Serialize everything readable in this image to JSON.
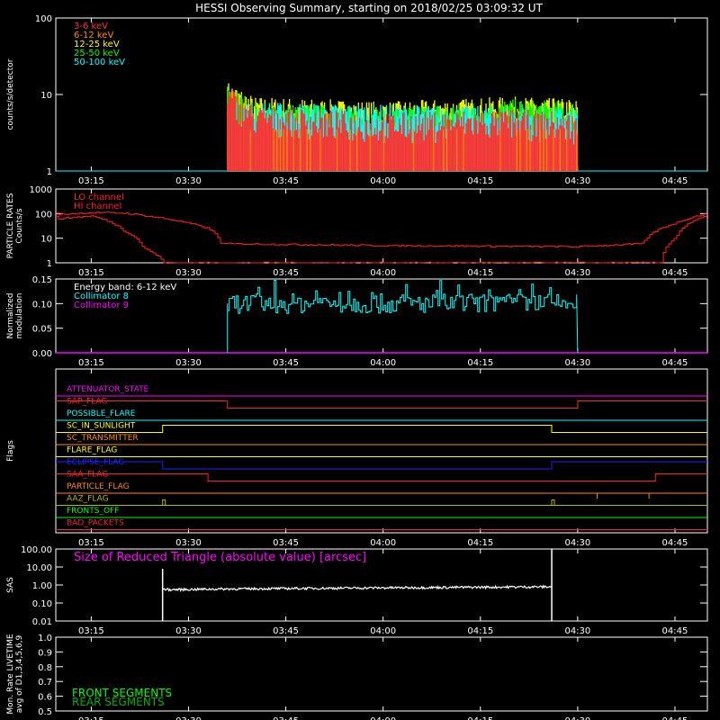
{
  "title": "HESSI Observing Summary, starting on 2018/02/25 03:09:32 UT",
  "time_ticks": [
    "03:15",
    "03:30",
    "03:45",
    "04:00",
    "04:15",
    "04:30",
    "04:45"
  ],
  "chart_data": [
    {
      "type": "line",
      "panel": "count-rates",
      "ylabel": "counts/s/detector",
      "yscale": "log",
      "ylim": [
        1,
        100
      ],
      "yticks": [
        "1",
        "10",
        "100"
      ],
      "xlim": [
        "03:09:32",
        "04:50"
      ],
      "legend": [
        {
          "name": "3-6 keV",
          "color": "#ff3030"
        },
        {
          "name": "6-12 keV",
          "color": "#ff8c00"
        },
        {
          "name": "12-25 keV",
          "color": "#ffff00"
        },
        {
          "name": "25-50 keV",
          "color": "#00ff00"
        },
        {
          "name": "50-100 keV",
          "color": "#00ffff"
        }
      ],
      "series": [
        {
          "name": "6-12 keV",
          "x": [
            "03:09:32",
            "03:36",
            "03:36",
            "04:30",
            "04:30",
            "04:50"
          ],
          "y": [
            1,
            1,
            3.5,
            3.5,
            1,
            1
          ],
          "color": "#ff8c00"
        },
        {
          "name": "3-6 keV",
          "x": [
            "03:36",
            "03:40",
            "04:00",
            "04:20",
            "04:30"
          ],
          "y": [
            9,
            5,
            4,
            4.5,
            4
          ],
          "color": "#ff3030"
        },
        {
          "name": "12-25 keV",
          "x": [
            "03:36",
            "03:40",
            "04:00",
            "04:20",
            "04:30"
          ],
          "y": [
            11,
            7,
            6,
            7,
            6.5
          ],
          "color": "#ffff00"
        },
        {
          "name": "25-50 keV",
          "x": [
            "03:36",
            "03:40",
            "04:00",
            "04:20",
            "04:30"
          ],
          "y": [
            10,
            6,
            5,
            6.5,
            6
          ],
          "color": "#00ff00"
        },
        {
          "name": "50-100 keV",
          "x": [
            "03:09:32",
            "03:36",
            "03:36",
            "04:30",
            "04:30",
            "04:50"
          ],
          "y": [
            1,
            1,
            6,
            5,
            1,
            1
          ],
          "color": "#00ffff"
        }
      ]
    },
    {
      "type": "line",
      "panel": "particle-rates",
      "ylabel": "PARTICLE RATES Counts/s",
      "yscale": "log",
      "ylim": [
        1,
        1000
      ],
      "yticks": [
        "1",
        "10",
        "100",
        "1000"
      ],
      "legend": [
        {
          "name": "LO channel",
          "color": "#ff2020"
        },
        {
          "name": "HI channel",
          "color": "#ff2020"
        }
      ],
      "series": [
        {
          "name": "LO channel",
          "x": [
            "03:09:32",
            "03:15",
            "03:20",
            "03:25",
            "03:31",
            "03:33",
            "03:35",
            "04:00",
            "04:30",
            "04:40",
            "04:45",
            "04:50"
          ],
          "y": [
            90,
            110,
            105,
            70,
            35,
            25,
            6,
            5,
            4.5,
            6,
            40,
            100
          ],
          "color": "#ff2020"
        },
        {
          "name": "HI channel",
          "x": [
            "03:09:32",
            "03:15",
            "03:20",
            "03:23",
            "03:25",
            "03:26",
            "03:26",
            "04:43",
            "04:43",
            "04:45",
            "04:50"
          ],
          "y": [
            60,
            80,
            20,
            4,
            2,
            1.3,
            1,
            1,
            2,
            10,
            80
          ],
          "color": "#ff2020"
        }
      ]
    },
    {
      "type": "line",
      "panel": "modulation",
      "ylabel": "Normalized modulation",
      "ylim": [
        0,
        0.15
      ],
      "yticks": [
        "0.00",
        "0.05",
        "0.10",
        "0.15"
      ],
      "legend": [
        {
          "name": "Energy band: 6-12 keV",
          "color": "#ffffff"
        },
        {
          "name": "Collimator 8",
          "color": "#00ffff"
        },
        {
          "name": "Collimator 9",
          "color": "#ff00ff"
        }
      ],
      "series": [
        {
          "name": "Collimator 8",
          "x": [
            "03:36",
            "04:30"
          ],
          "y": [
            0.1,
            0.1
          ],
          "color": "#00ffff"
        },
        {
          "name": "Collimator 9",
          "x": [
            "03:09:32",
            "04:50"
          ],
          "y": [
            0,
            0
          ],
          "color": "#ff00ff"
        }
      ]
    },
    {
      "type": "line",
      "panel": "flags",
      "ylabel": "Flags",
      "flags": [
        {
          "name": "ATTENUATOR_STATE",
          "color": "#ff00ff",
          "segments": [
            [
              "03:09:32",
              "04:50",
              0
            ]
          ]
        },
        {
          "name": "SAP_FLAG",
          "color": "#ff2020",
          "segments": [
            [
              "03:09:32",
              "03:36",
              1
            ],
            [
              "03:36",
              "04:30",
              0
            ],
            [
              "04:30",
              "04:50",
              1
            ]
          ]
        },
        {
          "name": "POSSIBLE_FLARE",
          "color": "#00ffff",
          "segments": [
            [
              "03:09:32",
              "04:50",
              0
            ]
          ]
        },
        {
          "name": "SC_IN_SUNLIGHT",
          "color": "#ffff00",
          "segments": [
            [
              "03:09:32",
              "03:26",
              0
            ],
            [
              "03:26",
              "04:26",
              1
            ],
            [
              "04:26",
              "04:50",
              0
            ]
          ]
        },
        {
          "name": "SC_TRANSMITTER",
          "color": "#ff8c00",
          "segments": [
            [
              "03:09:32",
              "04:50",
              0
            ]
          ]
        },
        {
          "name": "FLARE_FLAG",
          "color": "#ffff00",
          "segments": [
            [
              "03:09:32",
              "04:50",
              0
            ]
          ]
        },
        {
          "name": "ECLIPSE_FLAG",
          "color": "#2020ff",
          "segments": [
            [
              "03:09:32",
              "03:26",
              1
            ],
            [
              "03:26",
              "04:26",
              0
            ],
            [
              "04:26",
              "04:50",
              1
            ]
          ]
        },
        {
          "name": "SAA_FLAG",
          "color": "#ff2020",
          "segments": [
            [
              "03:09:32",
              "03:33",
              1
            ],
            [
              "03:33",
              "04:42",
              0
            ],
            [
              "04:42",
              "04:50",
              1
            ]
          ]
        },
        {
          "name": "PARTICLE_FLAG",
          "color": "#ff8c00",
          "segments": [
            [
              "03:09:32",
              "04:50",
              0
            ]
          ],
          "spikes": [
            "04:33",
            "04:41"
          ]
        },
        {
          "name": "AAZ_FLAG",
          "color": "#b8b800",
          "segments": [
            [
              "03:09:32",
              "04:50",
              0
            ]
          ],
          "pulses": [
            "03:26",
            "04:26"
          ]
        },
        {
          "name": "FRONTS_OFF",
          "color": "#00ff00",
          "segments": [
            [
              "03:09:32",
              "04:50",
              0
            ]
          ]
        },
        {
          "name": "BAD_PACKETS",
          "color": "#ff2020",
          "segments": [
            [
              "03:09:32",
              "04:50",
              0
            ]
          ]
        }
      ]
    },
    {
      "type": "line",
      "panel": "sas",
      "ylabel": "SAS",
      "yscale": "log",
      "ylim": [
        0.01,
        100
      ],
      "yticks": [
        "0.01",
        "0.10",
        "1.00",
        "10.00",
        "100.00"
      ],
      "annotation": "Size of Reduced Triangle (absolute value) [arcsec]",
      "annotation_color": "#ff00ff",
      "series": [
        {
          "x": [
            "03:26",
            "03:27",
            "03:35",
            "04:00",
            "04:26"
          ],
          "y": [
            0.6,
            0.55,
            0.6,
            0.7,
            0.8
          ],
          "color": "#ffffff"
        }
      ]
    },
    {
      "type": "line",
      "panel": "livetime",
      "ylabel": "Mon. Rate LIVETIME avg of D1,3,4,5,6,9",
      "ylim": [
        0.5,
        1.0
      ],
      "yticks": [
        "0.5",
        "0.6",
        "0.7",
        "0.8",
        "0.9",
        "1.0"
      ],
      "legend": [
        {
          "name": "FRONT SEGMENTS",
          "color": "#00ff00"
        },
        {
          "name": "REAR SEGMENTS",
          "color": "#00b000"
        }
      ],
      "series": []
    }
  ]
}
